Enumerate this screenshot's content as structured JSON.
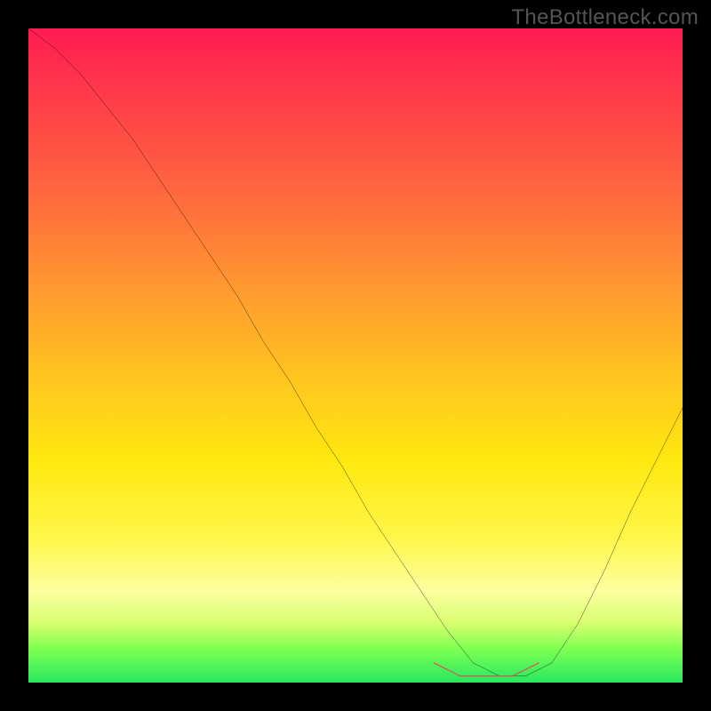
{
  "watermark": "TheBottleneck.com",
  "chart_data": {
    "type": "line",
    "title": "",
    "xlabel": "",
    "ylabel": "",
    "xlim": [
      0,
      100
    ],
    "ylim": [
      0,
      100
    ],
    "notes": "Bottleneck curve over gradient background; thin black curve descends from top-left to a flat minimum around x≈65-75, then rises again. A short red highlight marks the flat minimum. No axis ticks or labels are rendered in the image.",
    "series": [
      {
        "name": "bottleneck-curve",
        "color": "#000000",
        "x": [
          0,
          4,
          8,
          12,
          16,
          20,
          24,
          28,
          32,
          36,
          40,
          44,
          48,
          52,
          56,
          60,
          64,
          68,
          72,
          76,
          80,
          84,
          88,
          92,
          96,
          100
        ],
        "values": [
          100,
          97,
          93,
          88,
          83,
          77,
          71,
          65,
          59,
          52,
          46,
          39,
          33,
          26,
          20,
          14,
          8,
          3,
          1,
          1,
          3,
          9,
          17,
          26,
          34,
          42
        ]
      },
      {
        "name": "minimum-highlight",
        "color": "#d6555a",
        "x": [
          62,
          66,
          70,
          74,
          78
        ],
        "values": [
          3,
          1,
          1,
          1,
          3
        ]
      }
    ]
  }
}
